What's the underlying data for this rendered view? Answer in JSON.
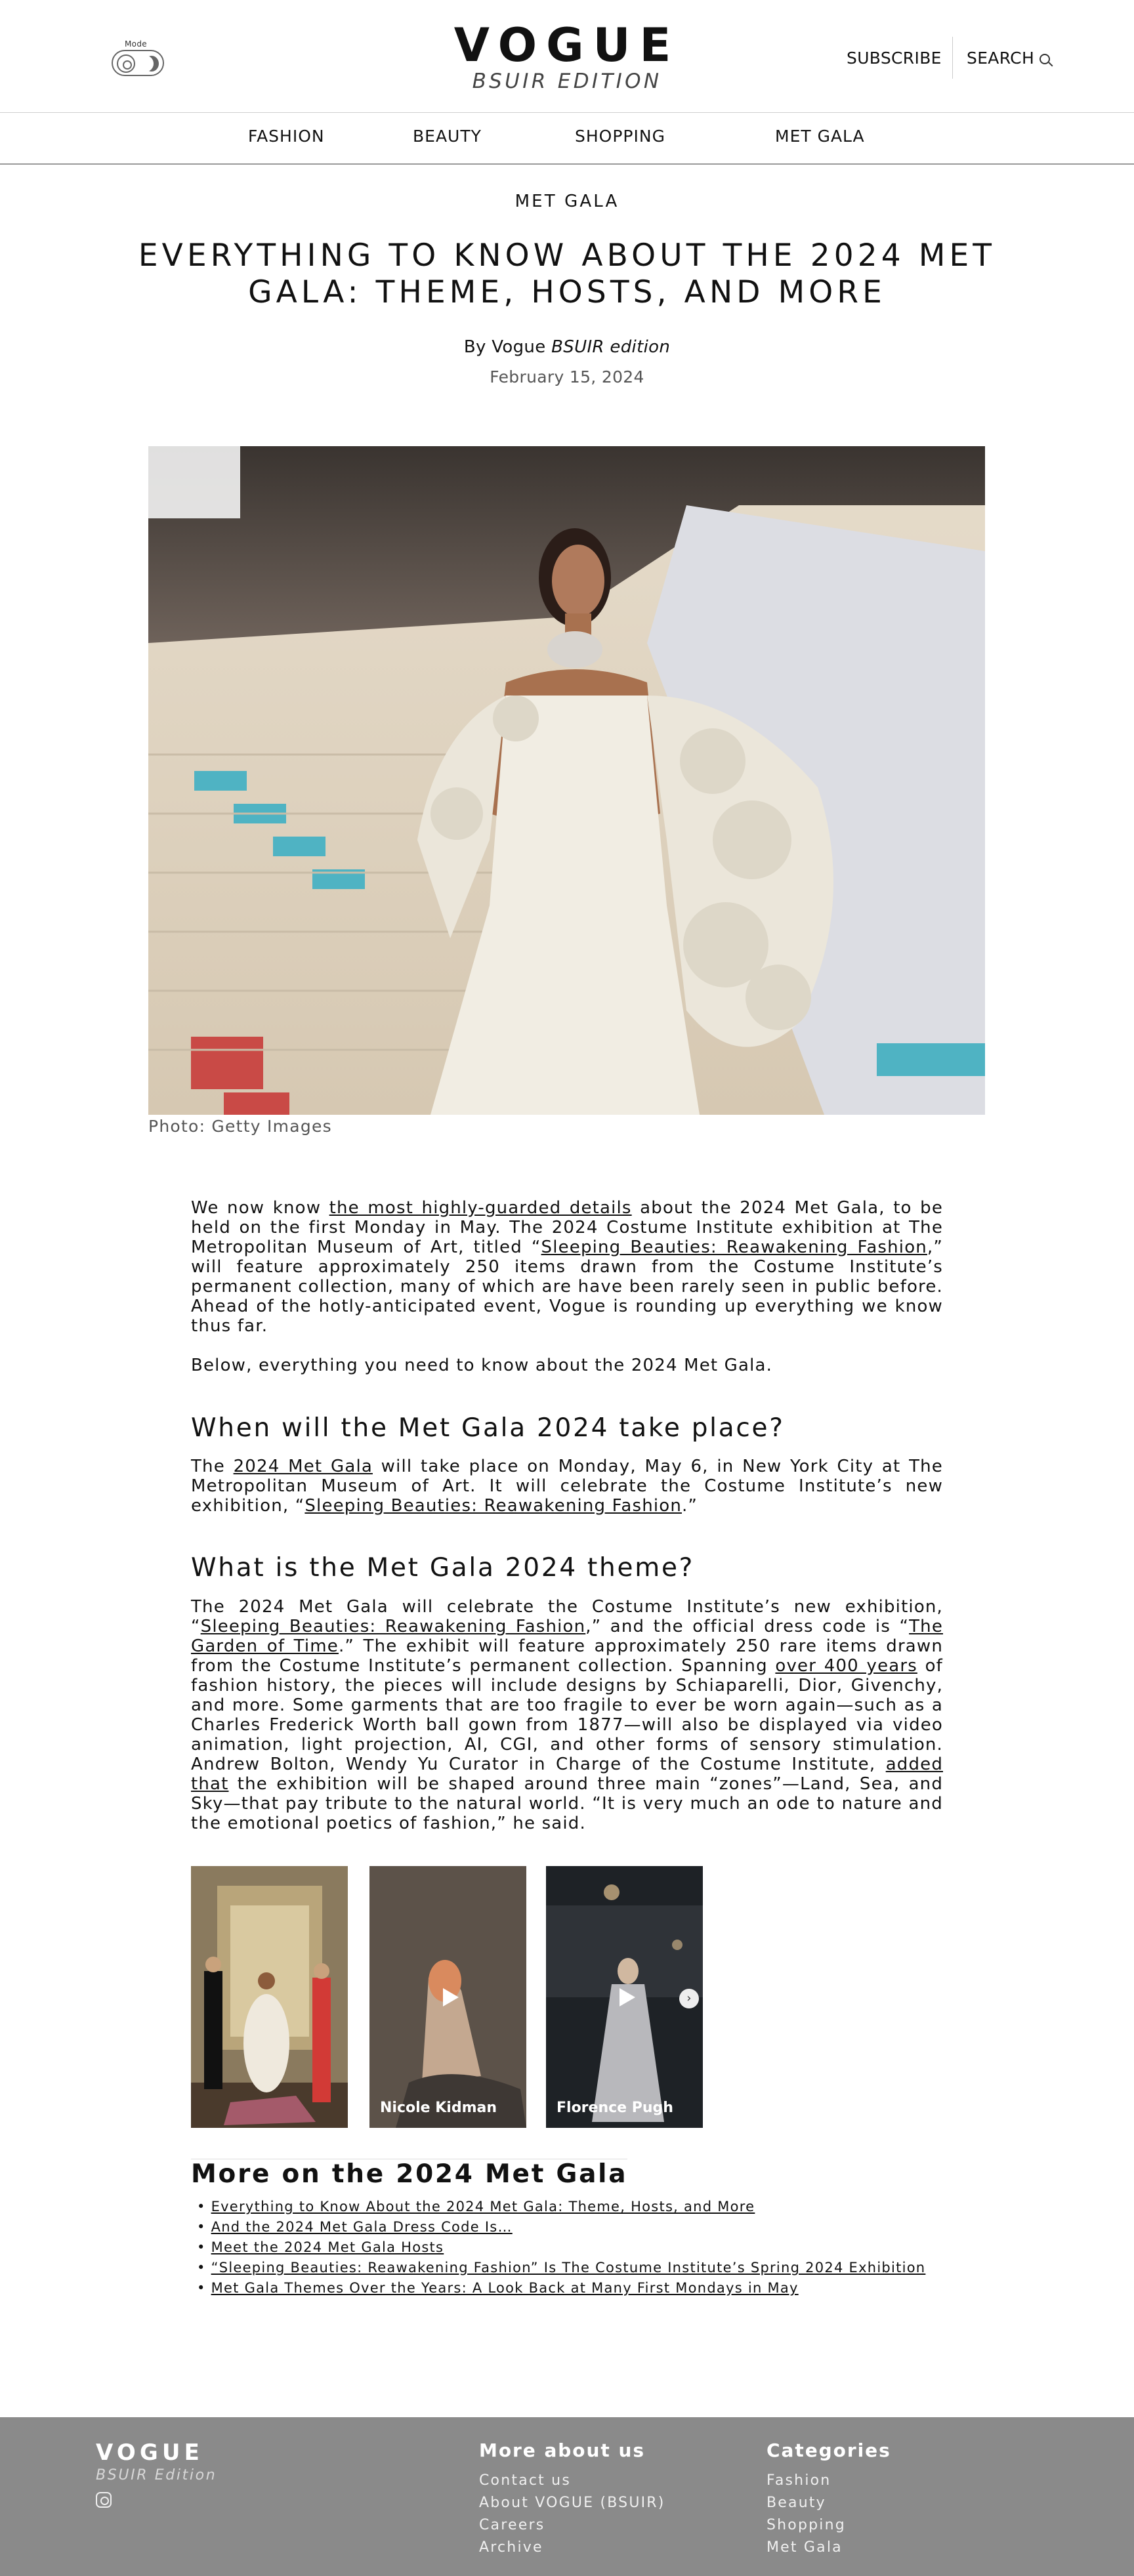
{
  "header": {
    "mode_label": "Mode",
    "brand_title": "VOGUE",
    "brand_subtitle": "BSUIR EDITION",
    "subscribe": "SUBSCRIBE",
    "search": "SEARCH"
  },
  "nav": {
    "items": [
      "FASHION",
      "BEAUTY",
      "SHOPPING",
      "MET GALA"
    ]
  },
  "article": {
    "kicker": "MET GALA",
    "headline": "EVERYTHING TO KNOW ABOUT THE 2024 MET GALA: THEME, HOSTS, AND MORE",
    "byline_prefix": "By Vogue",
    "byline_italic": "BSUIR edition",
    "date": "February 15, 2024",
    "hero_caption": "Photo: Getty Images",
    "p1": {
      "t1": "We now know ",
      "l1": "the most highly-guarded details",
      "t2": " about the 2024 Met Gala, to be held on the first Monday in May. The 2024 Costume Institute exhibition at The Metropolitan Museum of Art, titled “",
      "l2": "Sleeping Beauties: Reawakening Fashion",
      "t3": ",” will feature approximately 250 items drawn from the Costume Institute’s permanent collection, many of which are have been rarely seen in public before. Ahead of the hotly-anticipated event, Vogue is rounding up everything we know thus far."
    },
    "p2": "Below, everything you need to know about the 2024 Met Gala.",
    "h_when": "When will the Met Gala 2024 take place?",
    "p3": {
      "t1": "The ",
      "l1": "2024 Met Gala",
      "t2": " will take place on Monday, May 6, in New York City at The Metropolitan Museum of Art. It will celebrate the Costume Institute’s new exhibition, “",
      "l2": "Sleeping Beauties: Reawakening Fashion",
      "t3": ".”"
    },
    "h_theme": "What is the Met Gala 2024 theme?",
    "p4": {
      "t1": "The 2024 Met Gala will celebrate the Costume Institute’s new exhibition, “",
      "l1": "Sleeping Beauties: Reawakening Fashion",
      "t2": ",” and the official dress code is “",
      "l2": "The Garden of Time",
      "t3": ".” The exhibit will feature approximately 250 rare items drawn from the Costume Institute’s permanent collection. Spanning ",
      "l3": "over 400 years",
      "t4": " of fashion history, the pieces will include designs by Schiaparelli, Dior, Givenchy, and more. Some garments that are too fragile to ever be worn again—such as a Charles Frederick Worth ball gown from 1877—will also be displayed via video animation, light projection, AI, CGI, and other forms of sensory stimulation. Andrew Bolton, Wendy Yu Curator in Charge of the Costume Institute, ",
      "l4": "added that",
      "t5": " the exhibition will be shaped around three main “zones”—Land, Sea, and Sky—that pay tribute to the natural world. “It is very much an ode to nature and the emotional poetics of fashion,” he said."
    }
  },
  "gallery": {
    "cards": [
      {
        "label": ""
      },
      {
        "label": "Nicole Kidman"
      },
      {
        "label": "Florence Pugh"
      }
    ],
    "icons": [
      "play-icon",
      "chevron-right-icon"
    ]
  },
  "more": {
    "title": "More on the 2024 Met Gala",
    "links": [
      "Everything to Know About the 2024 Met Gala: Theme, Hosts, and More",
      "And the 2024 Met Gala Dress Code Is…",
      "Meet the 2024 Met Gala Hosts",
      "“Sleeping Beauties: Reawakening Fashion” Is The Costume Institute’s Spring 2024 Exhibition",
      "Met Gala Themes Over the Years: A Look Back at Many First Mondays in May"
    ]
  },
  "footer": {
    "brand": "VOGUE",
    "brand_sub": "BSUIR Edition",
    "col1_title": "More about us",
    "col1_links": [
      "Contact us",
      "About VOGUE (BSUIR)",
      "Careers",
      "Archive"
    ],
    "col2_title": "Categories",
    "col2_links": [
      "Fashion",
      "Beauty",
      "Shopping",
      "Met Gala"
    ],
    "icons": [
      "instagram-icon"
    ]
  }
}
